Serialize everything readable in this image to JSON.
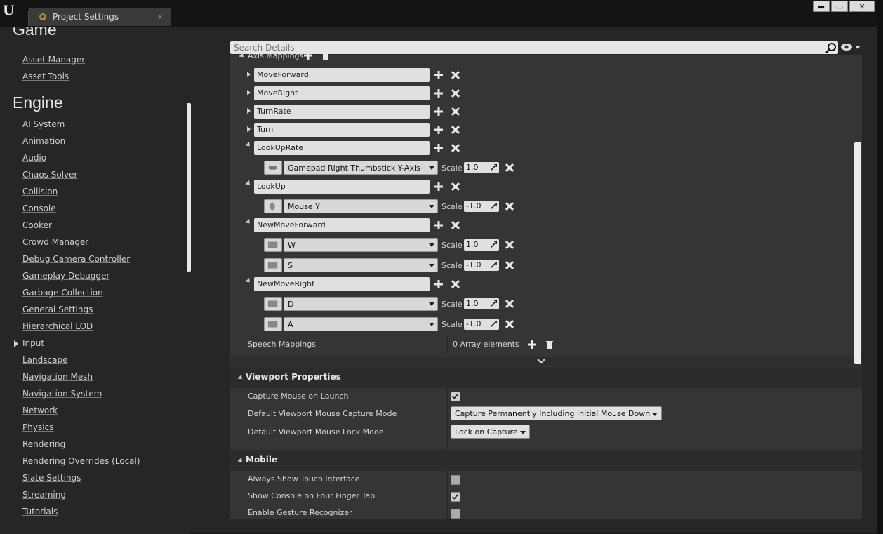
{
  "window": {
    "tab_title": "Project Settings",
    "tab_close": "×",
    "buttons": {
      "minimize": "▬",
      "maximize": "▭",
      "close": "✕"
    }
  },
  "sidebar": {
    "partial_heading": "Game",
    "game_items": [
      "Asset Manager",
      "Asset Tools"
    ],
    "engine_heading": "Engine",
    "engine_items": [
      "AI System",
      "Animation",
      "Audio",
      "Chaos Solver",
      "Collision",
      "Console",
      "Cooker",
      "Crowd Manager",
      "Debug Camera Controller",
      "Gameplay Debugger",
      "Garbage Collection",
      "General Settings",
      "Hierarchical LOD",
      "Input",
      "Landscape",
      "Navigation Mesh",
      "Navigation System",
      "Network",
      "Physics",
      "Rendering",
      "Rendering Overrides (Local)",
      "Slate Settings",
      "Streaming",
      "Tutorials"
    ],
    "selected_item": "Input"
  },
  "details": {
    "search_placeholder": "Search Details",
    "axis_mappings_label": "Axis Mappings",
    "mappings": [
      {
        "name": "MoveForward",
        "expanded": false,
        "keys": []
      },
      {
        "name": "MoveRight",
        "expanded": false,
        "keys": []
      },
      {
        "name": "TurnRate",
        "expanded": false,
        "keys": []
      },
      {
        "name": "Turn",
        "expanded": false,
        "keys": []
      },
      {
        "name": "LookUpRate",
        "expanded": true,
        "keys": [
          {
            "key": "Gamepad Right Thumbstick Y-Axis",
            "scale": "1.0",
            "icon": "gamepad-icon"
          }
        ]
      },
      {
        "name": "LookUp",
        "expanded": true,
        "keys": [
          {
            "key": "Mouse Y",
            "scale": "-1.0",
            "icon": "mouse-icon"
          }
        ]
      },
      {
        "name": "NewMoveForward",
        "expanded": true,
        "keys": [
          {
            "key": "W",
            "scale": "1.0",
            "icon": "keyboard-icon"
          },
          {
            "key": "S",
            "scale": "-1.0",
            "icon": "keyboard-icon"
          }
        ]
      },
      {
        "name": "NewMoveRight",
        "expanded": true,
        "keys": [
          {
            "key": "D",
            "scale": "1.0",
            "icon": "keyboard-icon"
          },
          {
            "key": "A",
            "scale": "-1.0",
            "icon": "keyboard-icon"
          }
        ]
      }
    ],
    "scale_label": "Scale",
    "speech_mappings_label": "Speech Mappings",
    "speech_mappings_value": "0 Array elements",
    "viewport": {
      "title": "Viewport Properties",
      "capture_mouse_label": "Capture Mouse on Launch",
      "capture_mouse_checked": true,
      "capture_mode_label": "Default Viewport Mouse Capture Mode",
      "capture_mode_value": "Capture Permanently Including Initial Mouse Down",
      "lock_mode_label": "Default Viewport Mouse Lock Mode",
      "lock_mode_value": "Lock on Capture"
    },
    "mobile": {
      "title": "Mobile",
      "items": [
        {
          "label": "Always Show Touch Interface",
          "checked": false
        },
        {
          "label": "Show Console on Four Finger Tap",
          "checked": true
        },
        {
          "label": "Enable Gesture Recognizer",
          "checked": false
        }
      ]
    }
  }
}
